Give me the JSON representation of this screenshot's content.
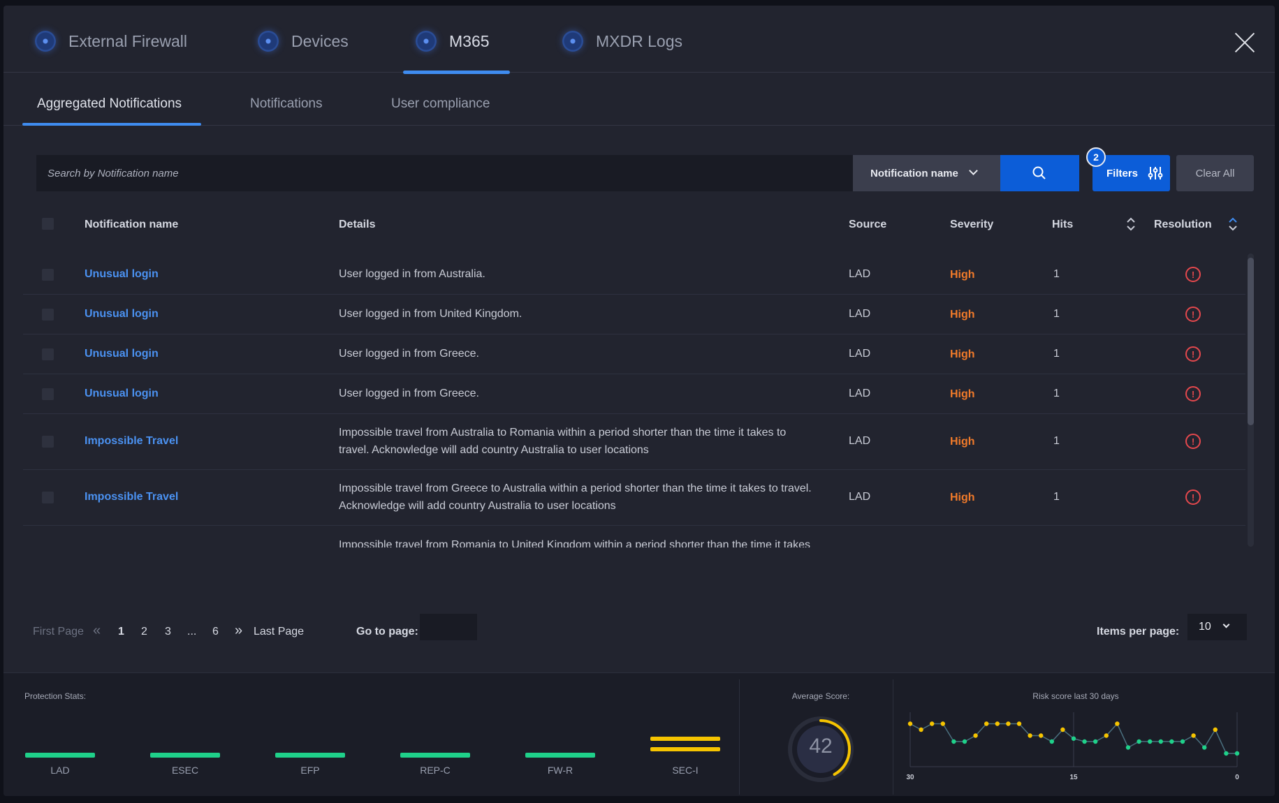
{
  "top_tabs": [
    {
      "label": "External Firewall",
      "icon": "globe-dot-icon"
    },
    {
      "label": "Devices",
      "icon": "globe-dot-icon"
    },
    {
      "label": "M365",
      "icon": "globe-dot-icon",
      "active": true
    },
    {
      "label": "MXDR Logs",
      "icon": "globe-dot-icon"
    }
  ],
  "sub_tabs": [
    {
      "label": "Aggregated Notifications",
      "active": true
    },
    {
      "label": "Notifications"
    },
    {
      "label": "User compliance"
    }
  ],
  "search": {
    "placeholder": "Search by Notification name",
    "field_select": "Notification name"
  },
  "filters": {
    "label": "Filters",
    "badge": "2"
  },
  "clear_all": "Clear All",
  "table": {
    "headers": {
      "name": "Notification name",
      "details": "Details",
      "source": "Source",
      "severity": "Severity",
      "hits": "Hits",
      "resolution": "Resolution"
    },
    "rows": [
      {
        "name": "Unusual login",
        "details": "User logged in from Australia.",
        "source": "LAD",
        "severity": "High",
        "hits": "1",
        "resolution": "!"
      },
      {
        "name": "Unusual login",
        "details": "User logged in from United Kingdom.",
        "source": "LAD",
        "severity": "High",
        "hits": "1",
        "resolution": "!"
      },
      {
        "name": "Unusual login",
        "details": "User logged in from Greece.",
        "source": "LAD",
        "severity": "High",
        "hits": "1",
        "resolution": "!"
      },
      {
        "name": "Unusual login",
        "details": "User logged in from Greece.",
        "source": "LAD",
        "severity": "High",
        "hits": "1",
        "resolution": "!"
      },
      {
        "name": "Impossible Travel",
        "details_l1": "Impossible travel from Australia to Romania within a period shorter than the time it takes to",
        "details_l2": "travel. Acknowledge will add country Australia to user locations",
        "source": "LAD",
        "severity": "High",
        "hits": "1",
        "resolution": "!"
      },
      {
        "name": "Impossible Travel",
        "details_l1": "Impossible travel from Greece to Australia within a period shorter than the time it takes to travel.",
        "details_l2": "Acknowledge will add country Australia to user locations",
        "source": "LAD",
        "severity": "High",
        "hits": "1",
        "resolution": "!"
      },
      {
        "details_l1": "Impossible travel from Romania to United Kingdom within a period shorter than the time it takes"
      }
    ]
  },
  "pagination": {
    "first": "First Page",
    "prev": "«",
    "pages": [
      "1",
      "2",
      "3",
      "...",
      "6"
    ],
    "next": "»",
    "last": "Last Page",
    "goto_label": "Go to page:",
    "items_label": "Items per page:",
    "items_value": "10"
  },
  "footer": {
    "protection_label": "Protection Stats:",
    "protection": [
      {
        "label": "LAD",
        "status": "green"
      },
      {
        "label": "ESEC",
        "status": "green"
      },
      {
        "label": "EFP",
        "status": "green"
      },
      {
        "label": "REP-C",
        "status": "green"
      },
      {
        "label": "FW-R",
        "status": "green"
      },
      {
        "label": "SEC-I",
        "status": "yellow"
      }
    ],
    "avg_label": "Average Score:",
    "avg_score": "42",
    "avg_fraction": 0.42,
    "risk_label": "Risk score last 30 days",
    "risk_ticks": [
      "30",
      "15",
      "0"
    ]
  },
  "chart_data": {
    "type": "line",
    "title": "Risk score last 30 days",
    "x_ticks": [
      "30",
      "15",
      "0"
    ],
    "x": [
      30,
      29,
      28,
      27,
      26,
      25,
      24,
      23,
      22,
      21,
      20,
      19,
      18,
      17,
      16,
      15,
      14,
      13,
      12,
      11,
      10,
      9,
      8,
      7,
      6,
      5,
      4,
      3,
      2,
      1,
      0
    ],
    "y": [
      70,
      60,
      70,
      70,
      40,
      40,
      50,
      70,
      70,
      70,
      70,
      50,
      50,
      40,
      60,
      45,
      40,
      40,
      50,
      70,
      30,
      40,
      40,
      40,
      40,
      40,
      50,
      30,
      60,
      20,
      20
    ],
    "point_colors": [
      "yellow",
      "yellow",
      "yellow",
      "yellow",
      "green",
      "green",
      "yellow",
      "yellow",
      "yellow",
      "yellow",
      "yellow",
      "yellow",
      "yellow",
      "green",
      "yellow",
      "green",
      "green",
      "green",
      "yellow",
      "yellow",
      "green",
      "green",
      "green",
      "green",
      "green",
      "green",
      "yellow",
      "green",
      "yellow",
      "green",
      "green"
    ],
    "colors": {
      "yellow": "#f6c400",
      "green": "#1fd18a",
      "line": "#4a6f7e"
    }
  },
  "colors": {
    "accent": "#0c5dd8",
    "link": "#4b92f2",
    "severity_high": "#f07a2a",
    "error": "#e5484d"
  }
}
